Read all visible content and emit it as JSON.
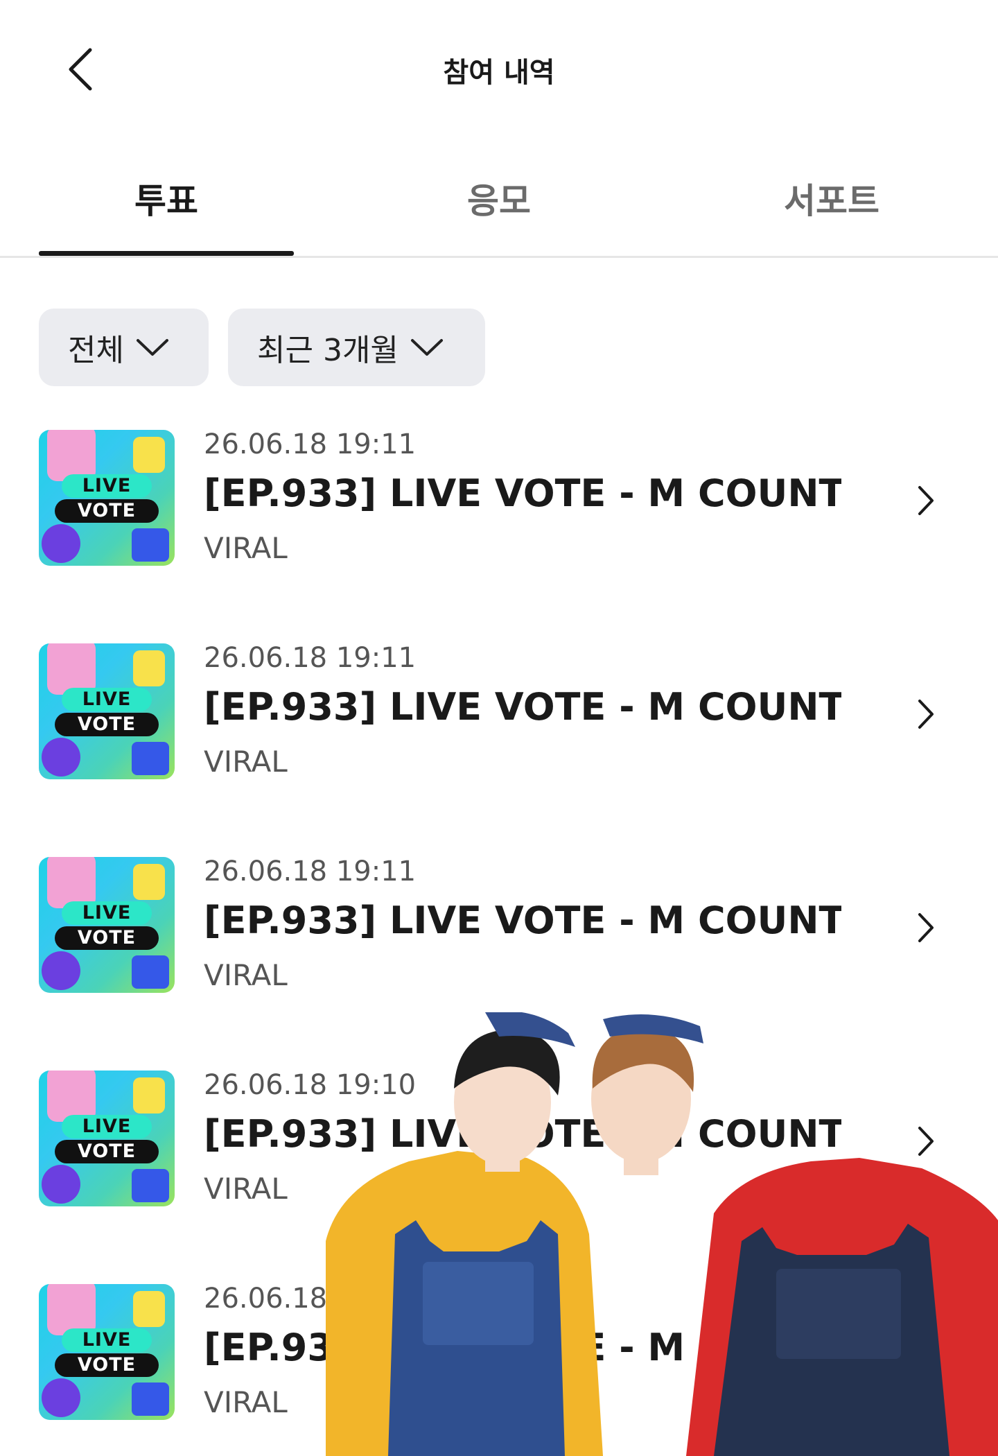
{
  "header": {
    "title": "참여 내역",
    "back_icon": "chevron-left-icon"
  },
  "tabs": [
    {
      "label": "투표",
      "active": true
    },
    {
      "label": "응모",
      "active": false
    },
    {
      "label": "서포트",
      "active": false
    }
  ],
  "filters": [
    {
      "label": "전체",
      "icon": "chevron-down-icon"
    },
    {
      "label": "최근 3개월",
      "icon": "chevron-down-icon"
    }
  ],
  "thumbnail": {
    "line1": "LIVE",
    "line2": "VOTE"
  },
  "items": [
    {
      "date": "26.06.18 19:11",
      "title": "[EP.933] LIVE VOTE - M COUNTD...",
      "category": "VIRAL"
    },
    {
      "date": "26.06.18 19:11",
      "title": "[EP.933] LIVE VOTE - M COUNTD...",
      "category": "VIRAL"
    },
    {
      "date": "26.06.18 19:11",
      "title": "[EP.933] LIVE VOTE - M COUNTD...",
      "category": "VIRAL"
    },
    {
      "date": "26.06.18 19:10",
      "title": "[EP.933] LIVE VOTE - M COUNTD...",
      "category": "VIRAL"
    },
    {
      "date": "26.06.18 19:10",
      "title": "[EP.933] LIVE VOTE - M COUNTD...",
      "category": "VIRAL"
    }
  ],
  "colors": {
    "text_primary": "#1a1a1a",
    "text_secondary": "#555555",
    "filter_bg": "#ebecf0",
    "divider": "#e6e6e6"
  }
}
